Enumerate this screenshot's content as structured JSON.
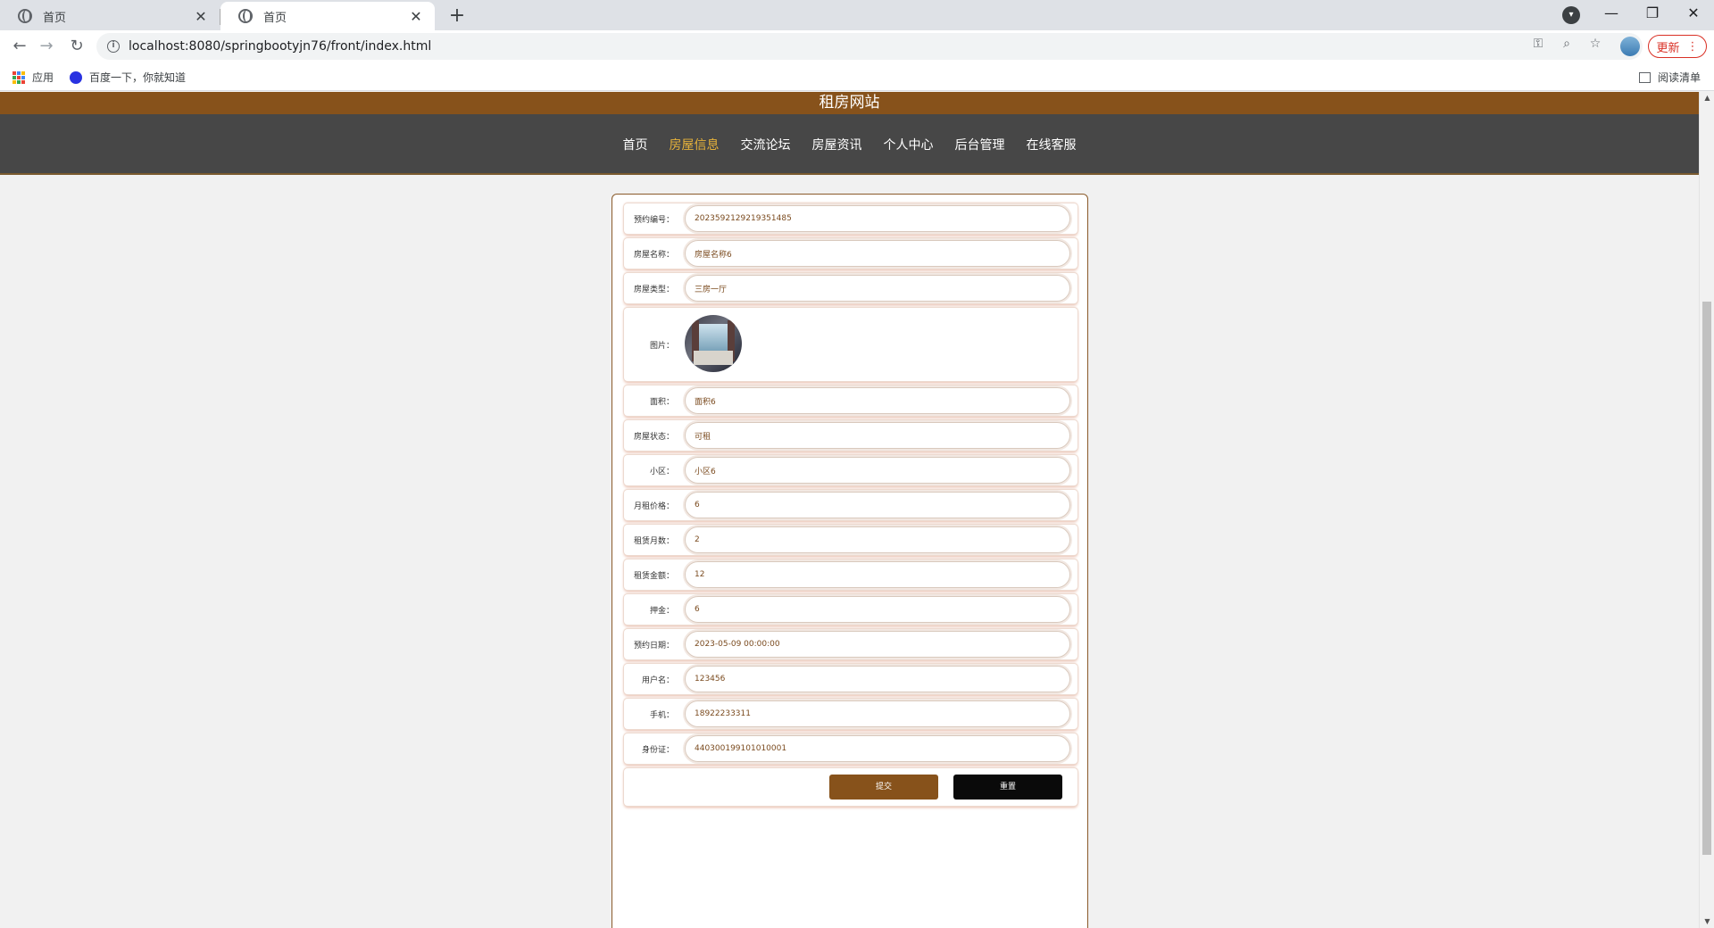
{
  "browser": {
    "tabs": [
      {
        "title": "首页",
        "active": false
      },
      {
        "title": "首页",
        "active": true
      }
    ],
    "new_tab": "+",
    "url": "localhost:8080/springbootyjn76/front/index.html",
    "update_label": "更新",
    "bookmarks": {
      "apps": "应用",
      "baidu": "百度一下，你就知道",
      "reading_list": "阅读清单"
    }
  },
  "site": {
    "title": "租房网站",
    "nav": [
      "首页",
      "房屋信息",
      "交流论坛",
      "房屋资讯",
      "个人中心",
      "后台管理",
      "在线客服"
    ],
    "active_nav": "房屋信息"
  },
  "form": {
    "fields": [
      {
        "label": "预约编号：",
        "value": "2023592129219351485"
      },
      {
        "label": "房屋名称：",
        "value": "房屋名称6"
      },
      {
        "label": "房屋类型：",
        "value": "三房一厅"
      },
      {
        "label": "图片：",
        "value": ""
      },
      {
        "label": "面积：",
        "value": "面积6"
      },
      {
        "label": "房屋状态：",
        "value": "可租"
      },
      {
        "label": "小区：",
        "value": "小区6"
      },
      {
        "label": "月租价格：",
        "value": "6"
      },
      {
        "label": "租赁月数：",
        "value": "2"
      },
      {
        "label": "租赁金额：",
        "value": "12"
      },
      {
        "label": "押金：",
        "value": "6"
      },
      {
        "label": "预约日期：",
        "value": "2023-05-09 00:00:00"
      },
      {
        "label": "用户名：",
        "value": "123456"
      },
      {
        "label": "手机：",
        "value": "18922233311"
      },
      {
        "label": "身份证：",
        "value": "440300199101010001"
      }
    ],
    "submit_label": "提交",
    "reset_label": "重置"
  },
  "colors": {
    "brand": "#87521b",
    "nav_bg": "#474747",
    "nav_active": "#e6b23a"
  }
}
